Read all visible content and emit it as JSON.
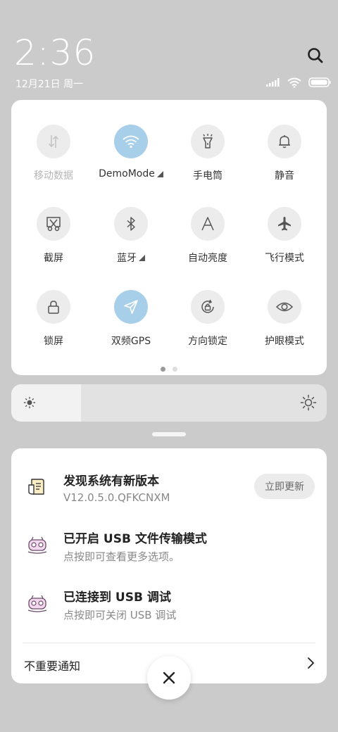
{
  "header": {
    "time": "2:36",
    "date": "12月21日 周一",
    "icons": [
      "search-icon",
      "cellular-signal-icon",
      "wifi-icon",
      "battery-icon"
    ]
  },
  "quick_settings": {
    "tiles": [
      {
        "label": "移动数据",
        "icon": "mobile-data-icon",
        "active": false,
        "disabled": true
      },
      {
        "label": "DemoMode",
        "icon": "wifi-icon",
        "active": true,
        "expandable": true
      },
      {
        "label": "手电筒",
        "icon": "flashlight-icon",
        "active": false
      },
      {
        "label": "静音",
        "icon": "bell-icon",
        "active": false
      },
      {
        "label": "截屏",
        "icon": "screenshot-icon",
        "active": false
      },
      {
        "label": "蓝牙",
        "icon": "bluetooth-icon",
        "active": false,
        "expandable": true
      },
      {
        "label": "自动亮度",
        "icon": "auto-brightness-icon",
        "active": false
      },
      {
        "label": "飞行模式",
        "icon": "airplane-icon",
        "active": false
      },
      {
        "label": "锁屏",
        "icon": "lock-icon",
        "active": false
      },
      {
        "label": "双频GPS",
        "icon": "location-arrow-icon",
        "active": true
      },
      {
        "label": "方向锁定",
        "icon": "rotation-lock-icon",
        "active": false
      },
      {
        "label": "护眼模式",
        "icon": "eye-icon",
        "active": false
      }
    ],
    "page_count": 2,
    "current_page": 1
  },
  "brightness": {
    "level": 0.22,
    "icons": [
      "brightness-low-icon",
      "brightness-high-icon"
    ]
  },
  "notifications": {
    "items": [
      {
        "title": "发现系统有新版本",
        "body": "V12.0.5.0.QFKCNXM",
        "action": "立即更新",
        "icon": "system-update-icon"
      },
      {
        "title": "已开启 USB 文件传输模式",
        "body": "点按即可查看更多选项。",
        "icon": "usb-app-icon"
      },
      {
        "title": "已连接到 USB 调试",
        "body": "点按即可关闭 USB 调试",
        "icon": "usb-app-icon"
      }
    ],
    "unimportant_label": "不重要通知"
  },
  "colors": {
    "background": "#cbcbcb",
    "active_tile": "#a8cfea",
    "inactive_tile": "#ececec"
  }
}
